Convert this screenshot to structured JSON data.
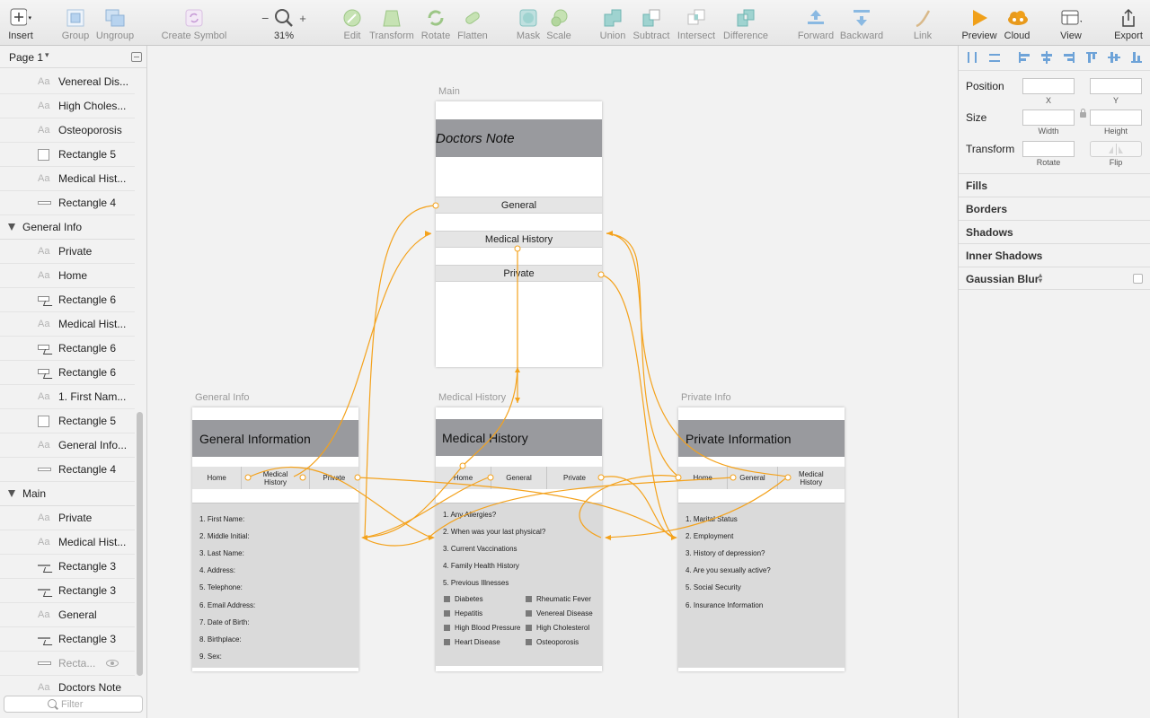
{
  "colors": {
    "accent": "#f4a21c",
    "header_gray": "#999a9e",
    "canvas_bg": "#f2f2f2"
  },
  "toolbar": {
    "insert": "Insert",
    "group": "Group",
    "ungroup": "Ungroup",
    "create_symbol": "Create Symbol",
    "zoom_minus": "−",
    "zoom_level": "31%",
    "zoom_plus": "+",
    "edit": "Edit",
    "transform": "Transform",
    "rotate": "Rotate",
    "flatten": "Flatten",
    "mask": "Mask",
    "scale": "Scale",
    "union": "Union",
    "subtract": "Subtract",
    "intersect": "Intersect",
    "difference": "Difference",
    "forward": "Forward",
    "backward": "Backward",
    "link": "Link",
    "preview": "Preview",
    "cloud": "Cloud",
    "view": "View",
    "export": "Export"
  },
  "sidebar": {
    "page": "Page 1",
    "filter_placeholder": "Filter",
    "items": [
      {
        "kind": "text",
        "label": "Venereal Dis..."
      },
      {
        "kind": "text",
        "label": "High Choles..."
      },
      {
        "kind": "text",
        "label": "Osteoporosis"
      },
      {
        "kind": "rect",
        "label": "Rectangle 5"
      },
      {
        "kind": "text",
        "label": "Medical Hist..."
      },
      {
        "kind": "line",
        "label": "Rectangle 4"
      },
      {
        "kind": "group",
        "label": "General Info"
      },
      {
        "kind": "text",
        "label": "Private"
      },
      {
        "kind": "text",
        "label": "Home"
      },
      {
        "kind": "hotspot",
        "label": "Rectangle 6"
      },
      {
        "kind": "text",
        "label": "Medical Hist..."
      },
      {
        "kind": "hotspot",
        "label": "Rectangle 6"
      },
      {
        "kind": "hotspot",
        "label": "Rectangle 6"
      },
      {
        "kind": "text",
        "label": "1. First Nam..."
      },
      {
        "kind": "rect",
        "label": "Rectangle 5"
      },
      {
        "kind": "text",
        "label": "General Info..."
      },
      {
        "kind": "line",
        "label": "Rectangle 4"
      },
      {
        "kind": "group",
        "label": "Main"
      },
      {
        "kind": "text",
        "label": "Private"
      },
      {
        "kind": "text",
        "label": "Medical Hist..."
      },
      {
        "kind": "hotline",
        "label": "Rectangle 3"
      },
      {
        "kind": "hotline",
        "label": "Rectangle 3"
      },
      {
        "kind": "text",
        "label": "General"
      },
      {
        "kind": "hotline",
        "label": "Rectangle 3"
      },
      {
        "kind": "hidden",
        "label": "Recta..."
      },
      {
        "kind": "text",
        "label": "Doctors Note"
      }
    ]
  },
  "canvas": {
    "main": {
      "label": "Main",
      "title": "Doctors Note",
      "buttons": [
        "General",
        "Medical History",
        "Private"
      ]
    },
    "general": {
      "label": "General Info",
      "title": "General Information",
      "nav": [
        "Home",
        "Medical History",
        "Private"
      ],
      "fields": [
        "1. First Name:",
        "2. Middle Initial:",
        "3. Last Name:",
        "4. Address:",
        "5. Telephone:",
        "6. Email Address:",
        "7. Date of Birth:",
        "8. Birthplace:",
        "9. Sex:"
      ]
    },
    "medical": {
      "label": "Medical History",
      "title": "Medical History",
      "nav": [
        "Home",
        "General",
        "Private"
      ],
      "questions": [
        "1. Any Allergies?",
        "2. When was your last physical?",
        "3. Current Vaccinations",
        "4. Family Health History",
        "5. Previous Illnesses"
      ],
      "illnesses_left": [
        "Diabetes",
        "Hepatitis",
        "High Blood Pressure",
        "Heart Disease"
      ],
      "illnesses_right": [
        "Rheumatic Fever",
        "Venereal Disease",
        "High Cholesterol",
        "Osteoporosis"
      ]
    },
    "private": {
      "label": "Private Info",
      "title": "Private Information",
      "nav": [
        "Home",
        "General",
        "Medical History"
      ],
      "questions": [
        "1. Marital Status",
        "2. Employment",
        "3. History of depression?",
        "4. Are you sexually active?",
        "5. Social Security",
        "6. Insurance Information"
      ]
    }
  },
  "inspector": {
    "position": "Position",
    "x": "X",
    "y": "Y",
    "size": "Size",
    "width": "Width",
    "height": "Height",
    "transform": "Transform",
    "rotate": "Rotate",
    "flip": "Flip",
    "sections": [
      "Fills",
      "Borders",
      "Shadows",
      "Inner Shadows",
      "Gaussian Blur"
    ]
  }
}
